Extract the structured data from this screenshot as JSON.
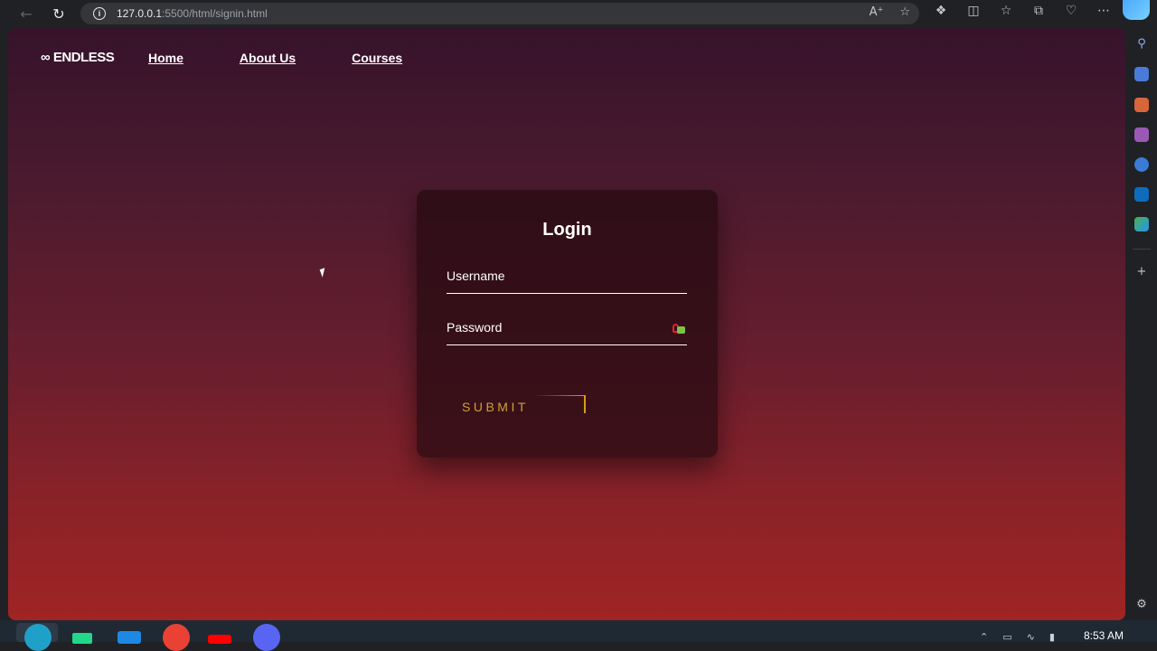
{
  "browser": {
    "url_host": "127.0.0.1",
    "url_path": ":5500/html/signin.html",
    "icons": {
      "back": "arrow-left-icon",
      "reload": "reload-icon",
      "read_aloud": "read-aloud-icon",
      "favorite": "star-icon",
      "extensions": "puzzle-icon",
      "split_screen": "split-screen-icon",
      "favorites": "favorites-list-icon",
      "collections": "collections-icon",
      "performance": "heart-pulse-icon",
      "more": "more-icon"
    }
  },
  "site": {
    "logo": "∞ ENDLESS",
    "nav": {
      "home": "Home",
      "about": "About Us",
      "courses": "Courses"
    }
  },
  "login": {
    "title": "Login",
    "username_label": "Username",
    "password_label": "Password",
    "submit_label": "SUBMIT"
  },
  "taskbar": {
    "clock": "8:53 AM"
  },
  "colors": {
    "gradient_top": "#36132b",
    "gradient_bottom": "#a02424",
    "submit_accent": "#d4a017"
  }
}
